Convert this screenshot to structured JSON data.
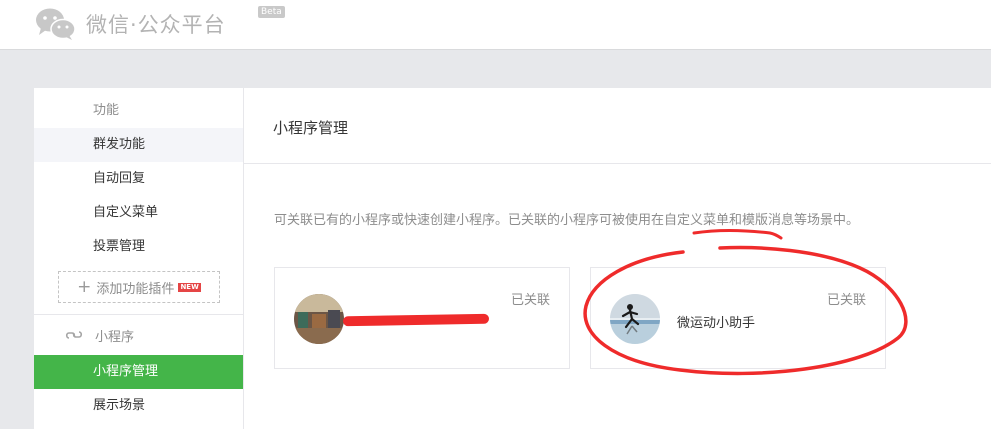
{
  "header": {
    "logo_text": "微信·公众平台",
    "beta": "Beta"
  },
  "sidebar": {
    "section_function": "功能",
    "items_function": [
      {
        "label": "群发功能"
      },
      {
        "label": "自动回复"
      },
      {
        "label": "自定义菜单"
      },
      {
        "label": "投票管理"
      }
    ],
    "add_plugin": "添加功能插件",
    "new_badge": "NEW",
    "section_miniprogram": "小程序",
    "items_miniprogram": [
      {
        "label": "小程序管理"
      },
      {
        "label": "展示场景"
      }
    ]
  },
  "main": {
    "title": "小程序管理",
    "description": "可关联已有的小程序或快速创建小程序。已关联的小程序可被使用在自定义菜单和模版消息等场景中。",
    "cards": [
      {
        "status": "已关联",
        "name": ""
      },
      {
        "status": "已关联",
        "name": "微运动小助手"
      }
    ]
  },
  "colors": {
    "active": "#44b549",
    "annotation": "#ef2b2b"
  }
}
